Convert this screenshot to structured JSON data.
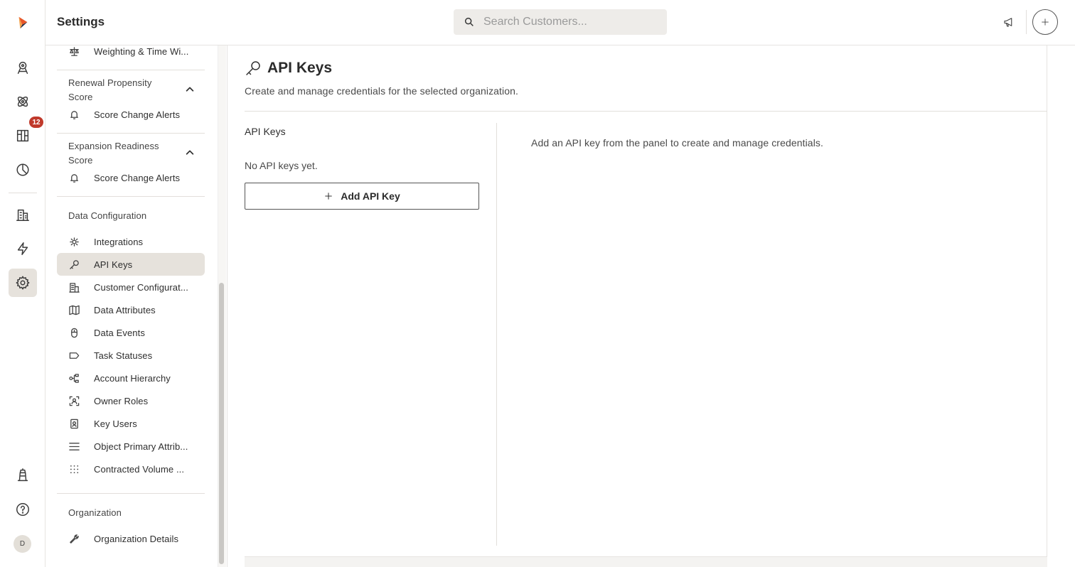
{
  "header": {
    "title": "Settings",
    "search_placeholder": "Search Customers..."
  },
  "rail": {
    "notifications_badge": "12",
    "avatar_initial": "D",
    "icons": [
      "logo-icon",
      "radar-icon",
      "atom-icon",
      "board-icon",
      "pie-chart-icon",
      "building-icon",
      "lightning-icon",
      "gear-icon",
      "lighthouse-icon",
      "help-icon"
    ]
  },
  "sidebar": {
    "top_item": "Weighting & Time Wi...",
    "renewal_group": "Renewal Propensity Score",
    "renewal_alerts": "Score Change Alerts",
    "expansion_group": "Expansion Readiness Score",
    "expansion_alerts": "Score Change Alerts",
    "data_config_heading": "Data Configuration",
    "items": [
      {
        "label": "Integrations"
      },
      {
        "label": "API Keys"
      },
      {
        "label": "Customer Configurat..."
      },
      {
        "label": "Data Attributes"
      },
      {
        "label": "Data Events"
      },
      {
        "label": "Task Statuses"
      },
      {
        "label": "Account Hierarchy"
      },
      {
        "label": "Owner Roles"
      },
      {
        "label": "Key Users"
      },
      {
        "label": "Object Primary Attrib..."
      },
      {
        "label": "Contracted Volume ..."
      }
    ],
    "org_heading": "Organization",
    "org_item": "Organization Details"
  },
  "main": {
    "title": "API Keys",
    "subtitle": "Create and manage credentials for the selected organization.",
    "keys_heading": "API Keys",
    "empty_text": "No API keys yet.",
    "add_button": "Add API Key",
    "right_panel_text": "Add an API key from the panel to create and manage credentials."
  },
  "colors": {
    "accent": "#e8572a",
    "active_bg": "#e6e2dc",
    "badge": "#c0392b"
  }
}
